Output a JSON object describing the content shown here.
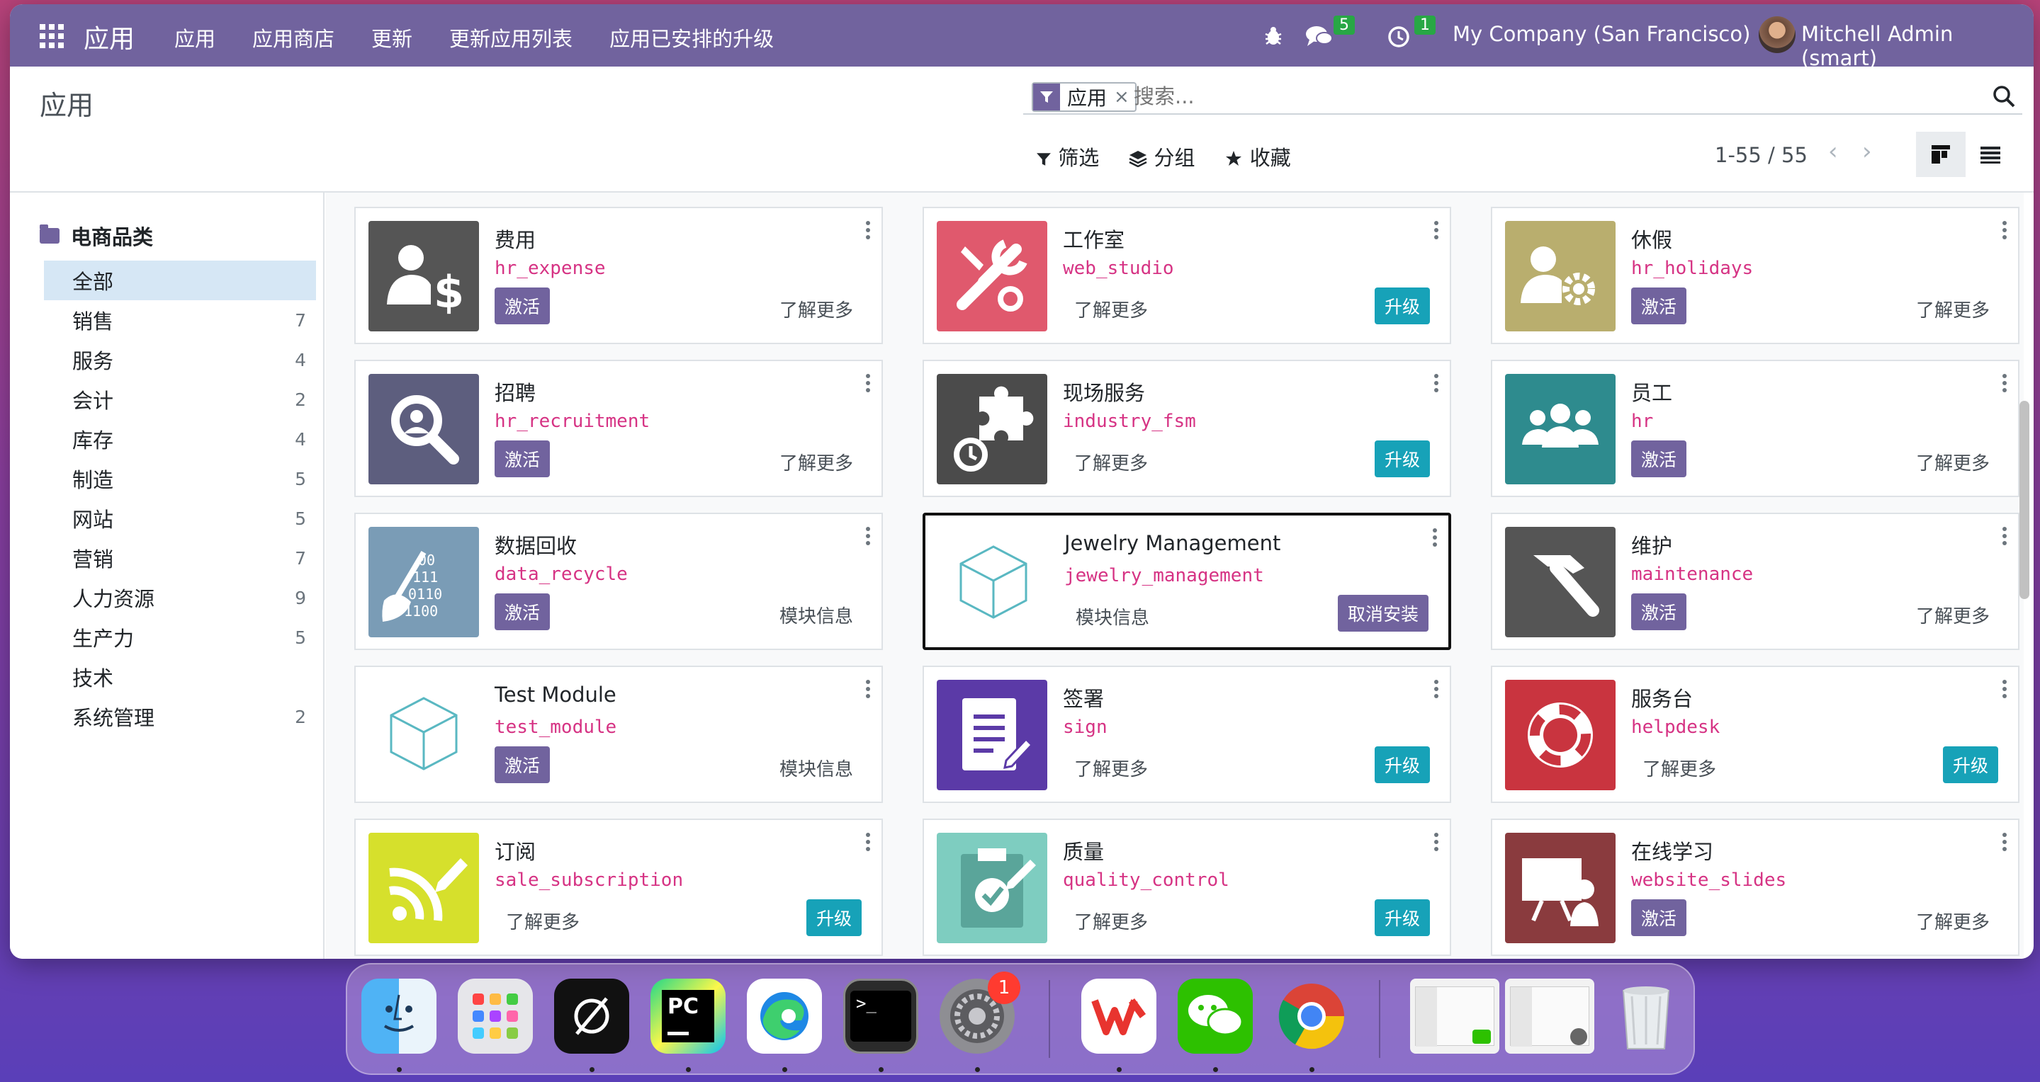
{
  "topbar": {
    "brand": "应用",
    "menu": [
      "应用",
      "应用商店",
      "更新",
      "更新应用列表",
      "应用已安排的升级"
    ],
    "messages_count": "5",
    "activity_count": "1",
    "company": "My Company (San Francisco)",
    "user": "Mitchell Admin (smart)"
  },
  "control_panel": {
    "title": "应用",
    "facet_label": "应用",
    "search_placeholder": "搜索...",
    "filters_label": "筛选",
    "groupby_label": "分组",
    "favorites_label": "收藏",
    "pager": "1-55 / 55"
  },
  "sidebar": {
    "header": "电商品类",
    "items": [
      {
        "label": "全部",
        "count": ""
      },
      {
        "label": "销售",
        "count": "7"
      },
      {
        "label": "服务",
        "count": "4"
      },
      {
        "label": "会计",
        "count": "2"
      },
      {
        "label": "库存",
        "count": "4"
      },
      {
        "label": "制造",
        "count": "5"
      },
      {
        "label": "网站",
        "count": "5"
      },
      {
        "label": "营销",
        "count": "7"
      },
      {
        "label": "人力资源",
        "count": "9"
      },
      {
        "label": "生产力",
        "count": "5"
      },
      {
        "label": "技术",
        "count": ""
      },
      {
        "label": "系统管理",
        "count": "2"
      }
    ]
  },
  "cards": [
    {
      "name": "费用",
      "tech": "hr_expense",
      "action": "激活",
      "link": "了解更多",
      "icon": "expense-icon",
      "color": "#555555"
    },
    {
      "name": "工作室",
      "tech": "web_studio",
      "action": "升级",
      "link": "了解更多",
      "icon": "studio-icon",
      "color": "#e0596d"
    },
    {
      "name": "休假",
      "tech": "hr_holidays",
      "action": "激活",
      "link": "了解更多",
      "icon": "time-off-icon",
      "color": "#b9ae6e"
    },
    {
      "name": "招聘",
      "tech": "hr_recruitment",
      "action": "激活",
      "link": "了解更多",
      "icon": "recruitment-icon",
      "color": "#5d5e7e"
    },
    {
      "name": "现场服务",
      "tech": "industry_fsm",
      "action": "升级",
      "link": "了解更多",
      "icon": "field-service-icon",
      "color": "#4b4b4b"
    },
    {
      "name": "员工",
      "tech": "hr",
      "action": "激活",
      "link": "了解更多",
      "icon": "employees-icon",
      "color": "#2e8b8e"
    },
    {
      "name": "数据回收",
      "tech": "data_recycle",
      "action": "激活",
      "link": "模块信息",
      "icon": "data-recycle-icon",
      "color": "#7a9cb6"
    },
    {
      "name": "Jewelry Management",
      "tech": "jewelry_management",
      "action": "取消安装",
      "link": "模块信息",
      "icon": "module-cube-icon",
      "color": "#ffffff"
    },
    {
      "name": "维护",
      "tech": "maintenance",
      "action": "激活",
      "link": "了解更多",
      "icon": "maintenance-icon",
      "color": "#555555"
    },
    {
      "name": "Test Module",
      "tech": "test_module",
      "action": "激活",
      "link": "模块信息",
      "icon": "module-cube-icon",
      "color": "#ffffff"
    },
    {
      "name": "签署",
      "tech": "sign",
      "action": "升级",
      "link": "了解更多",
      "icon": "sign-icon",
      "color": "#5b3aa7"
    },
    {
      "name": "服务台",
      "tech": "helpdesk",
      "action": "升级",
      "link": "了解更多",
      "icon": "helpdesk-icon",
      "color": "#c9343f"
    },
    {
      "name": "订阅",
      "tech": "sale_subscription",
      "action": "升级",
      "link": "了解更多",
      "icon": "subscription-icon",
      "color": "#d6e02c"
    },
    {
      "name": "质量",
      "tech": "quality_control",
      "action": "升级",
      "link": "了解更多",
      "icon": "quality-icon",
      "color": "#7ecdc0"
    },
    {
      "name": "在线学习",
      "tech": "website_slides",
      "action": "激活",
      "link": "了解更多",
      "icon": "elearning-icon",
      "color": "#8a3b3e"
    }
  ],
  "dock": {
    "settings_badge": "1",
    "apps": [
      "finder-icon",
      "launchpad-icon",
      "cursor-icon",
      "pycharm-icon",
      "edge-icon",
      "terminal-icon",
      "system-settings-icon",
      "wps-icon",
      "wechat-icon",
      "chrome-icon",
      "window-thumbnail-icon",
      "window-thumbnail-icon",
      "trash-icon"
    ]
  }
}
